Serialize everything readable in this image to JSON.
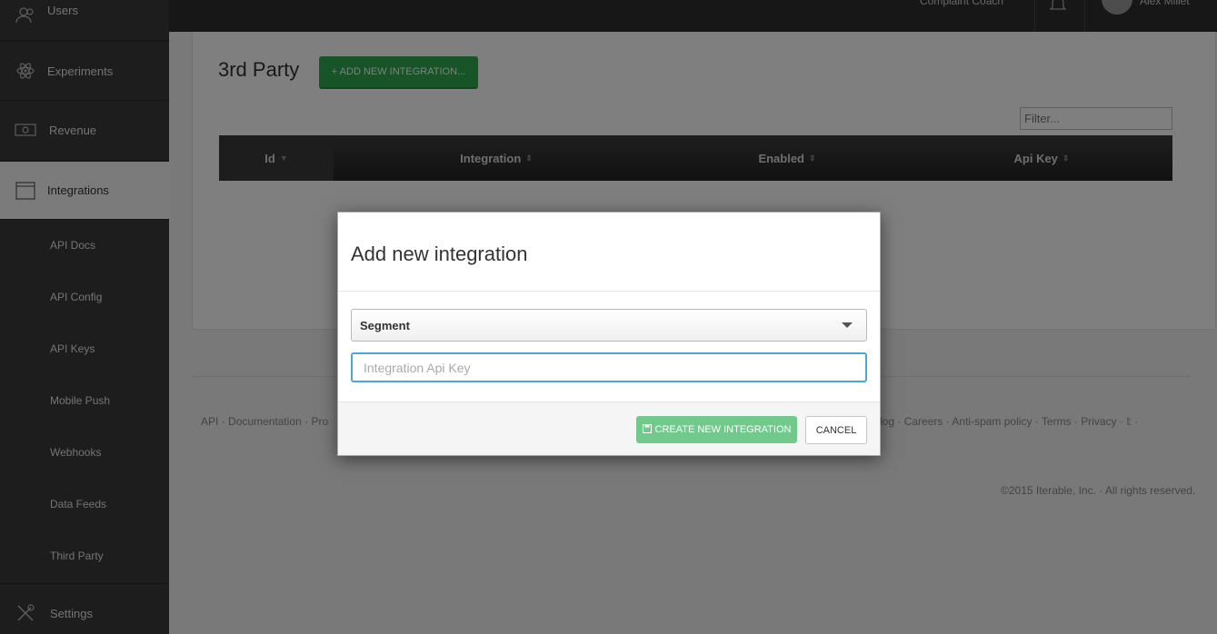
{
  "sidebar": {
    "items": [
      {
        "label": "Users",
        "icon": "users-icon"
      },
      {
        "label": "Experiments",
        "icon": "atom-icon"
      },
      {
        "label": "Revenue",
        "icon": "money-icon"
      },
      {
        "label": "Integrations",
        "icon": "window-icon"
      },
      {
        "label": "Settings",
        "icon": "tools-icon"
      }
    ],
    "sub_items": [
      "API Docs",
      "API Config",
      "API Keys",
      "Mobile Push",
      "Webhooks",
      "Data Feeds",
      "Third Party"
    ]
  },
  "topbar": {
    "company": "Complaint Coach",
    "user": "Alex Millet"
  },
  "page": {
    "title": "3rd Party",
    "add_button": "+ ADD NEW INTEGRATION...",
    "filter_placeholder": "Filter...",
    "columns": [
      "Id",
      "Integration",
      "Enabled",
      "Api Key"
    ]
  },
  "footer": {
    "links_left": [
      "API",
      "Documentation",
      "Pro"
    ],
    "links_right": [
      "log",
      "Careers",
      "Anti-spam policy",
      "Terms",
      "Privacy"
    ],
    "copyright": "©2015 Iterable, Inc. · All rights reserved."
  },
  "modal": {
    "title": "Add new integration",
    "select_value": "Segment",
    "input_placeholder": "Integration Api Key",
    "create_button": "CREATE NEW INTEGRATION",
    "cancel_button": "CANCEL"
  },
  "colors": {
    "primary_green": "#2fa84f",
    "focus_blue": "#4aa7d8",
    "sidebar_bg": "#3a3a3a"
  }
}
